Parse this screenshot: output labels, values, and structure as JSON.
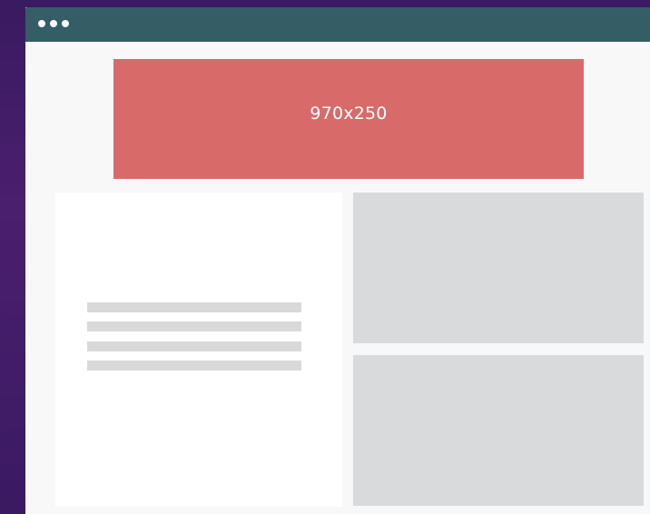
{
  "window": {
    "controls": [
      "window-dot",
      "window-dot",
      "window-dot"
    ]
  },
  "banner": {
    "label": "970x250",
    "color": "#d86b6a"
  },
  "colors": {
    "titlebar": "#345d66",
    "page_background": "#f8f8f8",
    "placeholder": "#d9dadb",
    "text_line": "#d9d9d9",
    "backdrop": "#3a1a60"
  }
}
